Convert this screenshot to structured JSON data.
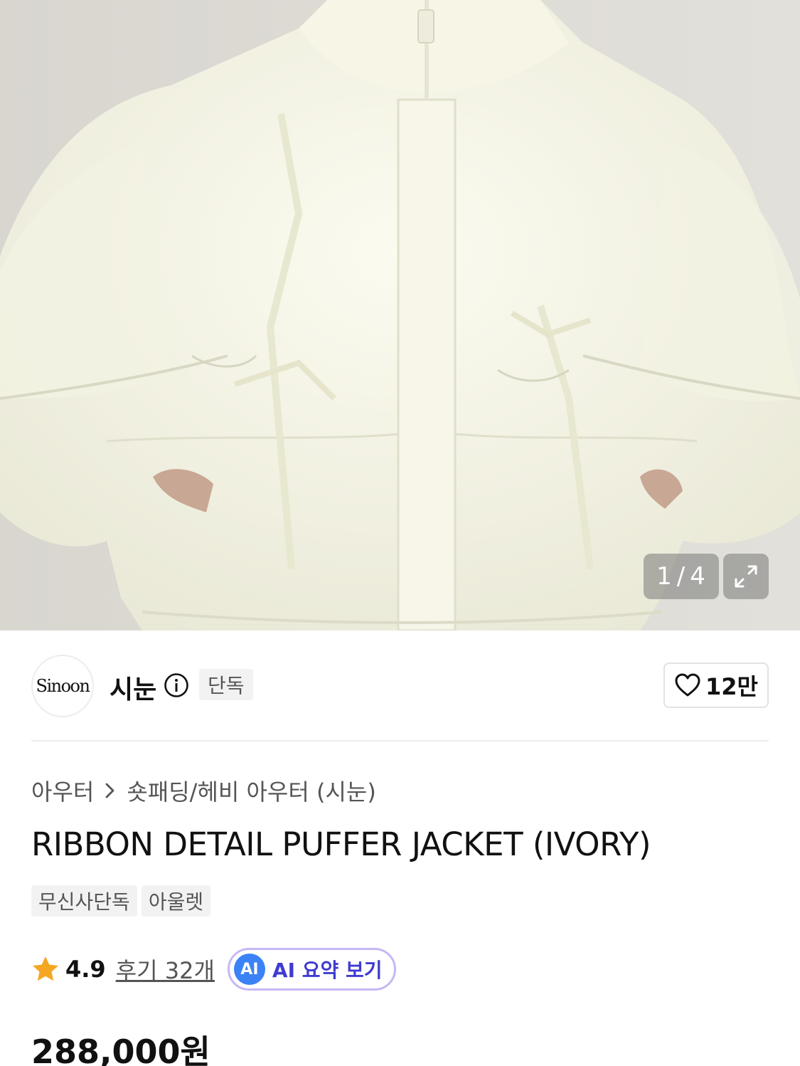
{
  "gallery": {
    "current": "1",
    "separator": "/",
    "total": "4",
    "expand_icon": "expand-icon"
  },
  "brand": {
    "logo_text": "Sinoon",
    "name": "시눈",
    "info_icon": "info-icon",
    "exclusive_label": "단독"
  },
  "like": {
    "icon": "heart-icon",
    "count": "12만"
  },
  "breadcrumb": {
    "items": [
      "아우터",
      "숏패딩/헤비 아우터 (시눈)"
    ]
  },
  "product": {
    "title": "RIBBON DETAIL PUFFER JACKET (IVORY)",
    "tags": [
      "무신사단독",
      "아울렛"
    ],
    "price": "288,000원"
  },
  "rating": {
    "score": "4.9",
    "review_link": "후기 32개",
    "ai_badge": "AI",
    "ai_label": "AI 요약 보기",
    "star_color": "#f5a623"
  },
  "colors": {
    "ai_text": "#3f3bd1",
    "ai_border": "#c7b7f5",
    "tag_bg": "#f2f2f2"
  }
}
